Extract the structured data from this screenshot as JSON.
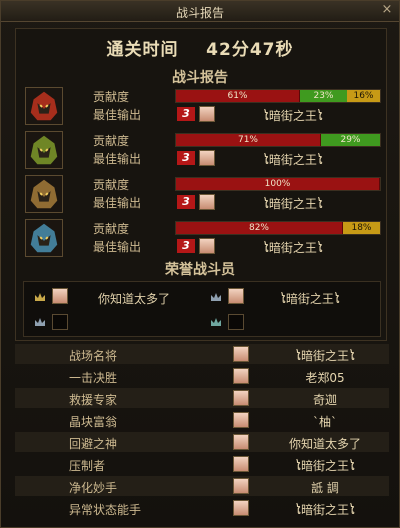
{
  "window": {
    "title": "战斗报告",
    "close_glyph": "×"
  },
  "summary": {
    "time_label": "通关时间",
    "time_value": "42分47秒"
  },
  "report_title": "战斗报告",
  "players": [
    {
      "contrib_label": "贡献度",
      "best_label": "最佳输出",
      "rank": "3",
      "best_name": "ໄ暗街之王ໄ",
      "bars": [
        {
          "text": "61%",
          "pct": 61,
          "color": "red"
        },
        {
          "text": "23%",
          "pct": 23,
          "color": "green"
        },
        {
          "text": "16%",
          "pct": 16,
          "color": "gold"
        }
      ],
      "accent": "#c0321e"
    },
    {
      "contrib_label": "贡献度",
      "best_label": "最佳输出",
      "rank": "3",
      "best_name": "ໄ暗街之王ໄ",
      "bars": [
        {
          "text": "71%",
          "pct": 71,
          "color": "red"
        },
        {
          "text": "29%",
          "pct": 29,
          "color": "green"
        }
      ],
      "accent": "#7f9a2a"
    },
    {
      "contrib_label": "贡献度",
      "best_label": "最佳输出",
      "rank": "3",
      "best_name": "ໄ暗街之王ໄ",
      "bars": [
        {
          "text": "100%",
          "pct": 100,
          "color": "red"
        }
      ],
      "accent": "#a67b3a"
    },
    {
      "contrib_label": "贡献度",
      "best_label": "最佳输出",
      "rank": "3",
      "best_name": "ໄ暗街之王ໄ",
      "bars": [
        {
          "text": "82%",
          "pct": 82,
          "color": "red"
        },
        {
          "text": "18%",
          "pct": 18,
          "color": "gold"
        }
      ],
      "accent": "#4a8fb0"
    }
  ],
  "honor": {
    "title": "荣誉战斗员",
    "entries": [
      {
        "name": "你知道太多了",
        "has_portrait": true
      },
      {
        "name": "ໄ暗街之王ໄ",
        "has_portrait": true
      },
      {
        "name": "",
        "has_portrait": false
      },
      {
        "name": "",
        "has_portrait": false
      }
    ]
  },
  "awards": [
    {
      "category": "战场名将",
      "name": "ໄ暗街之王ໄ"
    },
    {
      "category": "一击决胜",
      "name": "老郑05"
    },
    {
      "category": "救援专家",
      "name": "奇迦"
    },
    {
      "category": "晶块富翁",
      "name": "`柚`"
    },
    {
      "category": "回避之神",
      "name": "你知道太多了"
    },
    {
      "category": "压制者",
      "name": "ໄ暗街之王ໄ"
    },
    {
      "category": "净化妙手",
      "name": "詆  調"
    },
    {
      "category": "异常状态能手",
      "name": "ໄ暗街之王ໄ"
    }
  ],
  "colors": {
    "red": "#9a1212",
    "green": "#3f9a1f",
    "gold": "#c79a16"
  }
}
